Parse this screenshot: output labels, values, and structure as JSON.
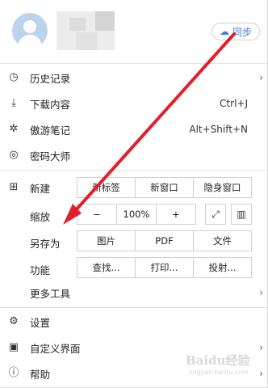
{
  "header": {
    "sync_label": "同步",
    "sync_icon": "cloud-icon"
  },
  "menu": {
    "history": "历史记录",
    "downloads": "下载内容",
    "downloads_shortcut": "Ctrl+J",
    "notes": "傲游笔记",
    "notes_shortcut": "Alt+Shift+N",
    "passwords": "密码大师",
    "new_label": "新建",
    "new_options": [
      "新标签",
      "新窗口",
      "隐身窗口"
    ],
    "zoom_label": "缩放",
    "zoom_minus": "−",
    "zoom_value": "100%",
    "zoom_plus": "+",
    "saveas_label": "另存为",
    "saveas_options": [
      "图片",
      "PDF",
      "文件"
    ],
    "function_label": "功能",
    "function_options": [
      "查找...",
      "打印...",
      "投射..."
    ],
    "more_tools": "更多工具",
    "settings": "设置",
    "customize": "自定义界面",
    "help": "帮助"
  },
  "watermark": {
    "text": "Baidu经验",
    "sub": "jingyan.baidu.com"
  },
  "colors": {
    "accent": "#3d7ee0",
    "arrow": "#e0202a"
  }
}
